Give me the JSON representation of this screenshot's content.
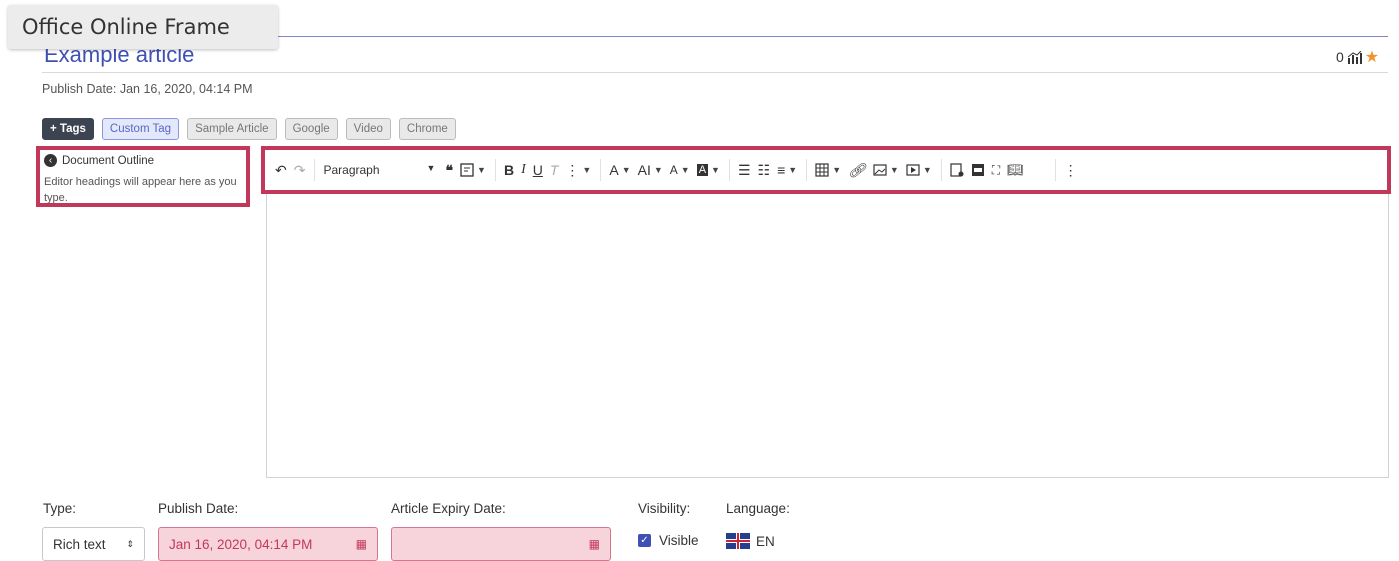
{
  "frame_label": "Office Online Frame",
  "article": {
    "title": "Example article",
    "rating_count": "0",
    "publish_date_line": "Publish Date: Jan 16, 2020, 04:14 PM"
  },
  "tags": {
    "add_label": "+ Tags",
    "items": [
      "Custom Tag",
      "Sample Article",
      "Google",
      "Video",
      "Chrome"
    ]
  },
  "outline": {
    "title": "Document Outline",
    "hint": "Editor headings will appear here as you type."
  },
  "toolbar": {
    "undo": "↶",
    "redo": "↷",
    "paragraph": "Paragraph",
    "bold": "B",
    "italic": "I",
    "underline": "U",
    "clear_format": "T",
    "more": "⋮",
    "font_size": "A",
    "font_family": "AI",
    "font_color": "A",
    "bg_color": "A",
    "more_vertical": "⋮"
  },
  "form": {
    "type_label": "Type:",
    "type_value": "Rich text",
    "publish_label": "Publish Date:",
    "publish_value": "Jan 16, 2020, 04:14 PM",
    "expiry_label": "Article Expiry Date:",
    "expiry_value": "",
    "visibility_label": "Visibility:",
    "visibility_value": "Visible",
    "language_label": "Language:",
    "language_value": "EN"
  },
  "colors": {
    "accent": "#3f51b5",
    "highlight_border": "#c2385a",
    "error_bg": "#f7d4dc",
    "star": "#f0932b"
  },
  "icons": [
    "chart-icon",
    "star-icon",
    "back-arrow-icon",
    "calendar-icon",
    "checkbox-icon",
    "uk-flag-icon"
  ]
}
